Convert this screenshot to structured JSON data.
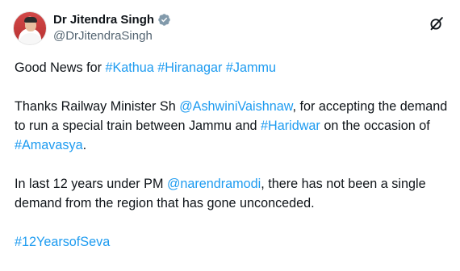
{
  "author": {
    "name": "Dr Jitendra Singh",
    "handle": "@DrJitendraSingh"
  },
  "icons": {
    "avatar": "profile-photo",
    "verified": "verified-badge-icon",
    "action": "grok-icon"
  },
  "colors": {
    "link": "#1d9bf0",
    "text": "#0f1419",
    "muted": "#536471"
  },
  "tweet": {
    "p1": {
      "t0": "Good News for ",
      "l0": "#Kathua",
      "t1": " ",
      "l1": "#Hiranagar",
      "t2": " ",
      "l2": "#Jammu"
    },
    "p2": {
      "t0": "Thanks Railway Minister Sh ",
      "l0": "@AshwiniVaishnaw",
      "t1": ", for accepting the demand to run a special train between Jammu and ",
      "l1": "#Haridwar",
      "t2": " on the occasion of ",
      "l2": "#Amavasya",
      "t3": "."
    },
    "p3": {
      "t0": "In last 12 years under PM ",
      "l0": "@narendramodi",
      "t1": ", there has not been a single demand from the region that has gone unconceded."
    },
    "p4": {
      "l0": "#12YearsofSeva"
    }
  }
}
